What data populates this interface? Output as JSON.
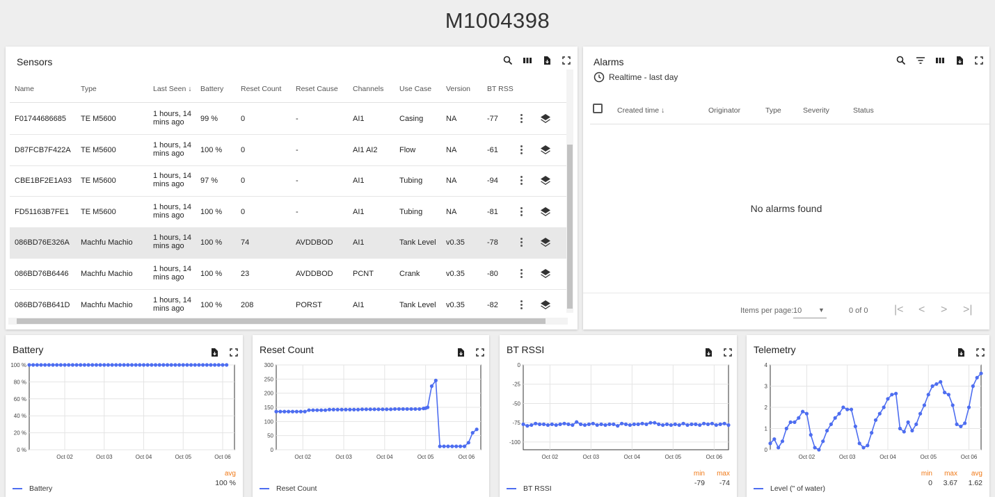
{
  "page_title": "M1004398",
  "colors": {
    "series": "#4d6df0",
    "stat_header": "#f07a19",
    "selected_row": "#e8e8e8"
  },
  "sensors": {
    "title": "Sensors",
    "toolbar_icons": [
      "search-icon",
      "columns-icon",
      "export-icon",
      "fullscreen-icon"
    ],
    "columns": [
      "Name",
      "Type",
      "Last Seen",
      "Battery",
      "Reset Count",
      "Reset Cause",
      "Channels",
      "Use Case",
      "Version",
      "BT RSS"
    ],
    "rows": [
      {
        "name": "F01744686685",
        "type": "TE M5600",
        "last_seen_1": "1 hours, 14",
        "last_seen_2": "mins ago",
        "battery": "99 %",
        "reset_count": "0",
        "reset_cause": "-",
        "channels": "AI1",
        "use_case": "Casing",
        "version": "NA",
        "bt_rss": "-77"
      },
      {
        "name": "D87FCB7F422A",
        "type": "TE M5600",
        "last_seen_1": "1 hours, 14",
        "last_seen_2": "mins ago",
        "battery": "100 %",
        "reset_count": "0",
        "reset_cause": "-",
        "channels": "AI1 AI2",
        "use_case": "Flow",
        "version": "NA",
        "bt_rss": "-61"
      },
      {
        "name": "CBE1BF2E1A93",
        "type": "TE M5600",
        "last_seen_1": "1 hours, 14",
        "last_seen_2": "mins ago",
        "battery": "97 %",
        "reset_count": "0",
        "reset_cause": "-",
        "channels": "AI1",
        "use_case": "Tubing",
        "version": "NA",
        "bt_rss": "-94"
      },
      {
        "name": "FD51163B7FE1",
        "type": "TE M5600",
        "last_seen_1": "1 hours, 14",
        "last_seen_2": "mins ago",
        "battery": "100 %",
        "reset_count": "0",
        "reset_cause": "-",
        "channels": "AI1",
        "use_case": "Tubing",
        "version": "NA",
        "bt_rss": "-81"
      },
      {
        "name": "086BD76E326A",
        "type": "Machfu Machio",
        "last_seen_1": "1 hours, 14",
        "last_seen_2": "mins ago",
        "battery": "100 %",
        "reset_count": "74",
        "reset_cause": "AVDDBOD",
        "channels": "AI1",
        "use_case": "Tank Level",
        "version": "v0.35",
        "bt_rss": "-78",
        "selected": true
      },
      {
        "name": "086BD76B6446",
        "type": "Machfu Machio",
        "last_seen_1": "1 hours, 14",
        "last_seen_2": "mins ago",
        "battery": "100 %",
        "reset_count": "23",
        "reset_cause": "AVDDBOD",
        "channels": "PCNT",
        "use_case": "Crank",
        "version": "v0.35",
        "bt_rss": "-80"
      },
      {
        "name": "086BD76B641D",
        "type": "Machfu Machio",
        "last_seen_1": "1 hours, 14",
        "last_seen_2": "mins ago",
        "battery": "100 %",
        "reset_count": "208",
        "reset_cause": "PORST",
        "channels": "AI1",
        "use_case": "Tank Level",
        "version": "v0.35",
        "bt_rss": "-82"
      }
    ]
  },
  "alarms": {
    "title": "Alarms",
    "time_window": "Realtime - last day",
    "columns": [
      "Created time",
      "Originator",
      "Type",
      "Severity",
      "Status"
    ],
    "empty_text": "No alarms found",
    "items_per_page_label": "Items per page:",
    "items_per_page": "10",
    "range_text": "0 of 0"
  },
  "chart_data": [
    {
      "type": "line",
      "title": "Battery",
      "x_ticks": [
        "Oct 02",
        "Oct 03",
        "Oct 04",
        "Oct 05",
        "Oct 06"
      ],
      "y_ticks": [
        "0 %",
        "20 %",
        "40 %",
        "60 %",
        "80 %",
        "100 %"
      ],
      "ylim": [
        0,
        100
      ],
      "xlim": [
        0,
        5.2
      ],
      "series": [
        {
          "name": "Battery",
          "x": [
            0,
            0.1,
            0.2,
            0.3,
            0.4,
            0.5,
            0.6,
            0.7,
            0.8,
            0.9,
            1,
            1.1,
            1.2,
            1.3,
            1.4,
            1.5,
            1.6,
            1.7,
            1.8,
            1.9,
            2,
            2.1,
            2.2,
            2.3,
            2.4,
            2.5,
            2.6,
            2.7,
            2.8,
            2.9,
            3,
            3.1,
            3.2,
            3.3,
            3.4,
            3.5,
            3.6,
            3.7,
            3.8,
            3.9,
            4,
            4.1,
            4.2,
            4.3,
            4.4,
            4.5,
            4.6,
            4.7,
            4.8,
            4.9,
            5
          ],
          "values": [
            100,
            100,
            100,
            100,
            100,
            100,
            100,
            100,
            100,
            100,
            100,
            100,
            100,
            100,
            100,
            100,
            100,
            100,
            100,
            100,
            100,
            100,
            100,
            100,
            100,
            100,
            100,
            100,
            100,
            100,
            100,
            100,
            100,
            100,
            100,
            100,
            100,
            100,
            100,
            100,
            100,
            100,
            100,
            100,
            100,
            100,
            100,
            100,
            100,
            100,
            100
          ]
        }
      ],
      "stats": {
        "headers": [
          "avg"
        ],
        "values": [
          "100 %"
        ]
      }
    },
    {
      "type": "line",
      "title": "Reset Count",
      "x_ticks": [
        "Oct 02",
        "Oct 03",
        "Oct 04",
        "Oct 05",
        "Oct 06"
      ],
      "y_ticks": [
        "0",
        "50",
        "100",
        "150",
        "200",
        "250",
        "300"
      ],
      "ylim": [
        0,
        300
      ],
      "xlim": [
        0,
        5.0
      ],
      "series": [
        {
          "name": "Reset Count",
          "x": [
            0,
            0.1,
            0.2,
            0.3,
            0.4,
            0.5,
            0.6,
            0.7,
            0.8,
            0.9,
            1,
            1.1,
            1.2,
            1.3,
            1.4,
            1.5,
            1.6,
            1.7,
            1.8,
            1.9,
            2,
            2.1,
            2.2,
            2.3,
            2.4,
            2.5,
            2.6,
            2.7,
            2.8,
            2.9,
            3,
            3.1,
            3.2,
            3.3,
            3.4,
            3.5,
            3.6,
            3.65,
            3.7,
            3.8,
            3.9,
            4,
            4.1,
            4.2,
            4.3,
            4.4,
            4.5,
            4.6,
            4.7,
            4.8,
            4.9
          ],
          "values": [
            135,
            135,
            135,
            135,
            135,
            135,
            135,
            135,
            140,
            140,
            140,
            140,
            140,
            142,
            142,
            142,
            142,
            142,
            142,
            142,
            142,
            143,
            143,
            143,
            143,
            143,
            143,
            143,
            143,
            144,
            144,
            144,
            144,
            144,
            144,
            144,
            146,
            147,
            150,
            225,
            245,
            12,
            12,
            12,
            12,
            12,
            12,
            12,
            25,
            60,
            72
          ]
        }
      ],
      "stats": {
        "headers": [],
        "values": []
      }
    },
    {
      "type": "line",
      "title": "BT RSSI",
      "x_ticks": [
        "Oct 02",
        "Oct 03",
        "Oct 04",
        "Oct 05",
        "Oct 06"
      ],
      "y_ticks": [
        "-100",
        "-75",
        "-50",
        "-25",
        "0"
      ],
      "ylim": [
        -110,
        0
      ],
      "xlim": [
        0,
        5.0
      ],
      "series": [
        {
          "name": "BT RSSI",
          "x": [
            0,
            0.1,
            0.2,
            0.3,
            0.4,
            0.5,
            0.6,
            0.7,
            0.8,
            0.9,
            1,
            1.1,
            1.2,
            1.3,
            1.4,
            1.5,
            1.6,
            1.7,
            1.8,
            1.9,
            2,
            2.1,
            2.2,
            2.3,
            2.4,
            2.5,
            2.6,
            2.7,
            2.8,
            2.9,
            3,
            3.1,
            3.2,
            3.3,
            3.4,
            3.5,
            3.6,
            3.7,
            3.8,
            3.9,
            4,
            4.1,
            4.2,
            4.3,
            4.4,
            4.5,
            4.6,
            4.7,
            4.8,
            4.9,
            5
          ],
          "values": [
            -77,
            -79,
            -78,
            -76,
            -77,
            -77,
            -78,
            -77,
            -78,
            -77,
            -76,
            -77,
            -78,
            -74,
            -77,
            -78,
            -77,
            -76,
            -78,
            -77,
            -78,
            -77,
            -77,
            -79,
            -76,
            -77,
            -78,
            -77,
            -77,
            -76,
            -77,
            -75,
            -75,
            -77,
            -78,
            -77,
            -78,
            -77,
            -78,
            -76,
            -78,
            -77,
            -77,
            -78,
            -76,
            -77,
            -76,
            -78,
            -77,
            -76,
            -78
          ]
        }
      ],
      "stats": {
        "headers": [
          "min",
          "max"
        ],
        "values": [
          "-79",
          "-74"
        ]
      }
    },
    {
      "type": "line",
      "title": "Telemetry",
      "x_ticks": [
        "Oct 02",
        "Oct 03",
        "Oct 04",
        "Oct 05",
        "Oct 06"
      ],
      "y_ticks": [
        "0",
        "1",
        "2",
        "3",
        "4"
      ],
      "ylim": [
        0,
        4
      ],
      "xlim": [
        0,
        5.2
      ],
      "series": [
        {
          "name": "Level (\" of water)",
          "x": [
            0,
            0.1,
            0.2,
            0.3,
            0.4,
            0.5,
            0.6,
            0.7,
            0.8,
            0.9,
            1,
            1.1,
            1.2,
            1.3,
            1.4,
            1.5,
            1.6,
            1.7,
            1.8,
            1.9,
            2,
            2.1,
            2.2,
            2.3,
            2.4,
            2.5,
            2.6,
            2.7,
            2.8,
            2.9,
            3,
            3.1,
            3.2,
            3.3,
            3.4,
            3.5,
            3.6,
            3.7,
            3.8,
            3.9,
            4,
            4.1,
            4.2,
            4.3,
            4.4,
            4.5,
            4.6,
            4.7,
            4.8,
            4.9,
            5,
            5.1,
            5.2
          ],
          "values": [
            0.3,
            0.5,
            0.1,
            0.4,
            1.0,
            1.3,
            1.3,
            1.5,
            1.8,
            1.7,
            0.7,
            0.1,
            0.0,
            0.4,
            0.9,
            1.2,
            1.5,
            1.7,
            2.0,
            1.9,
            1.9,
            1.1,
            0.3,
            0.1,
            0.2,
            0.8,
            1.4,
            1.7,
            2.0,
            2.4,
            2.6,
            2.65,
            1.0,
            0.85,
            1.3,
            0.9,
            1.2,
            1.7,
            2.1,
            2.6,
            3.0,
            3.1,
            3.2,
            2.7,
            2.6,
            2.1,
            1.2,
            1.1,
            1.25,
            2.0,
            3.0,
            3.4,
            3.6
          ]
        }
      ],
      "stats": {
        "headers": [
          "min",
          "max",
          "avg"
        ],
        "values": [
          "0",
          "3.67",
          "1.62"
        ]
      }
    }
  ]
}
